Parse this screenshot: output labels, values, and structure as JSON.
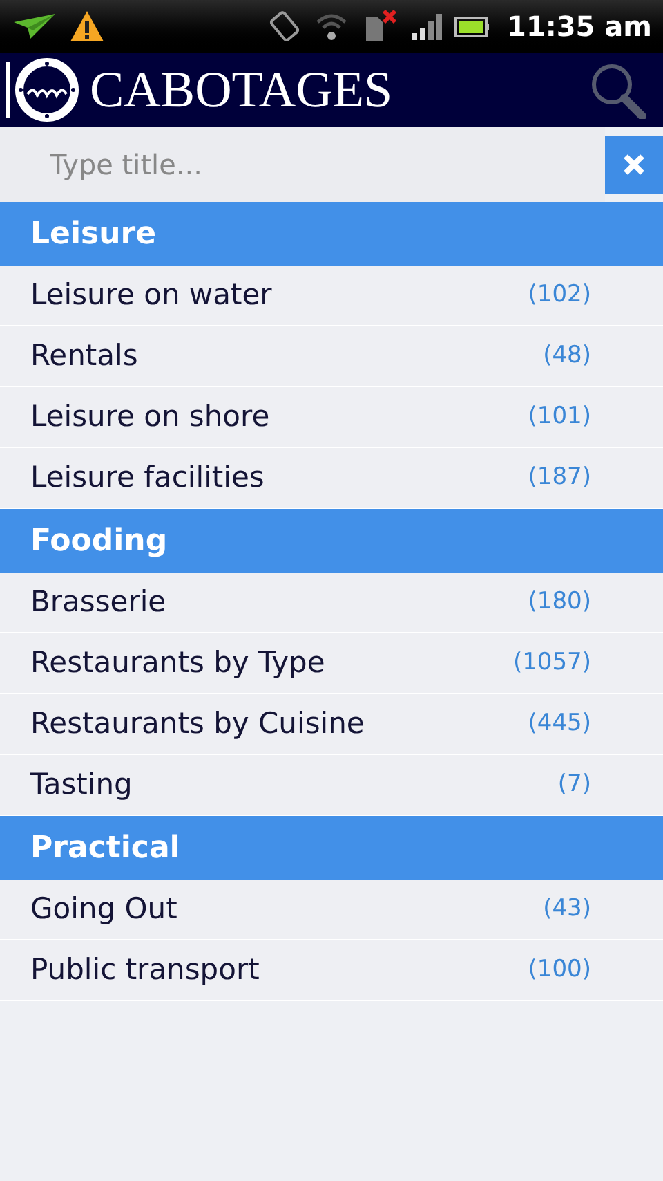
{
  "status_bar": {
    "time": "11:35 am"
  },
  "header": {
    "title": "CABOTAGES"
  },
  "search": {
    "placeholder": "Type title..."
  },
  "sections": [
    {
      "title": "Leisure",
      "items": [
        {
          "label": "Leisure on water",
          "count": "(102)"
        },
        {
          "label": "Rentals",
          "count": "(48)"
        },
        {
          "label": "Leisure on shore",
          "count": "(101)"
        },
        {
          "label": "Leisure facilities",
          "count": "(187)"
        }
      ]
    },
    {
      "title": "Fooding",
      "items": [
        {
          "label": "Brasserie",
          "count": "(180)"
        },
        {
          "label": "Restaurants by Type",
          "count": "(1057)"
        },
        {
          "label": "Restaurants by Cuisine",
          "count": "(445)"
        },
        {
          "label": "Tasting",
          "count": "(7)"
        }
      ]
    },
    {
      "title": "Practical",
      "items": [
        {
          "label": "Going Out",
          "count": "(43)"
        },
        {
          "label": "Public transport",
          "count": "(100)"
        }
      ]
    }
  ]
}
